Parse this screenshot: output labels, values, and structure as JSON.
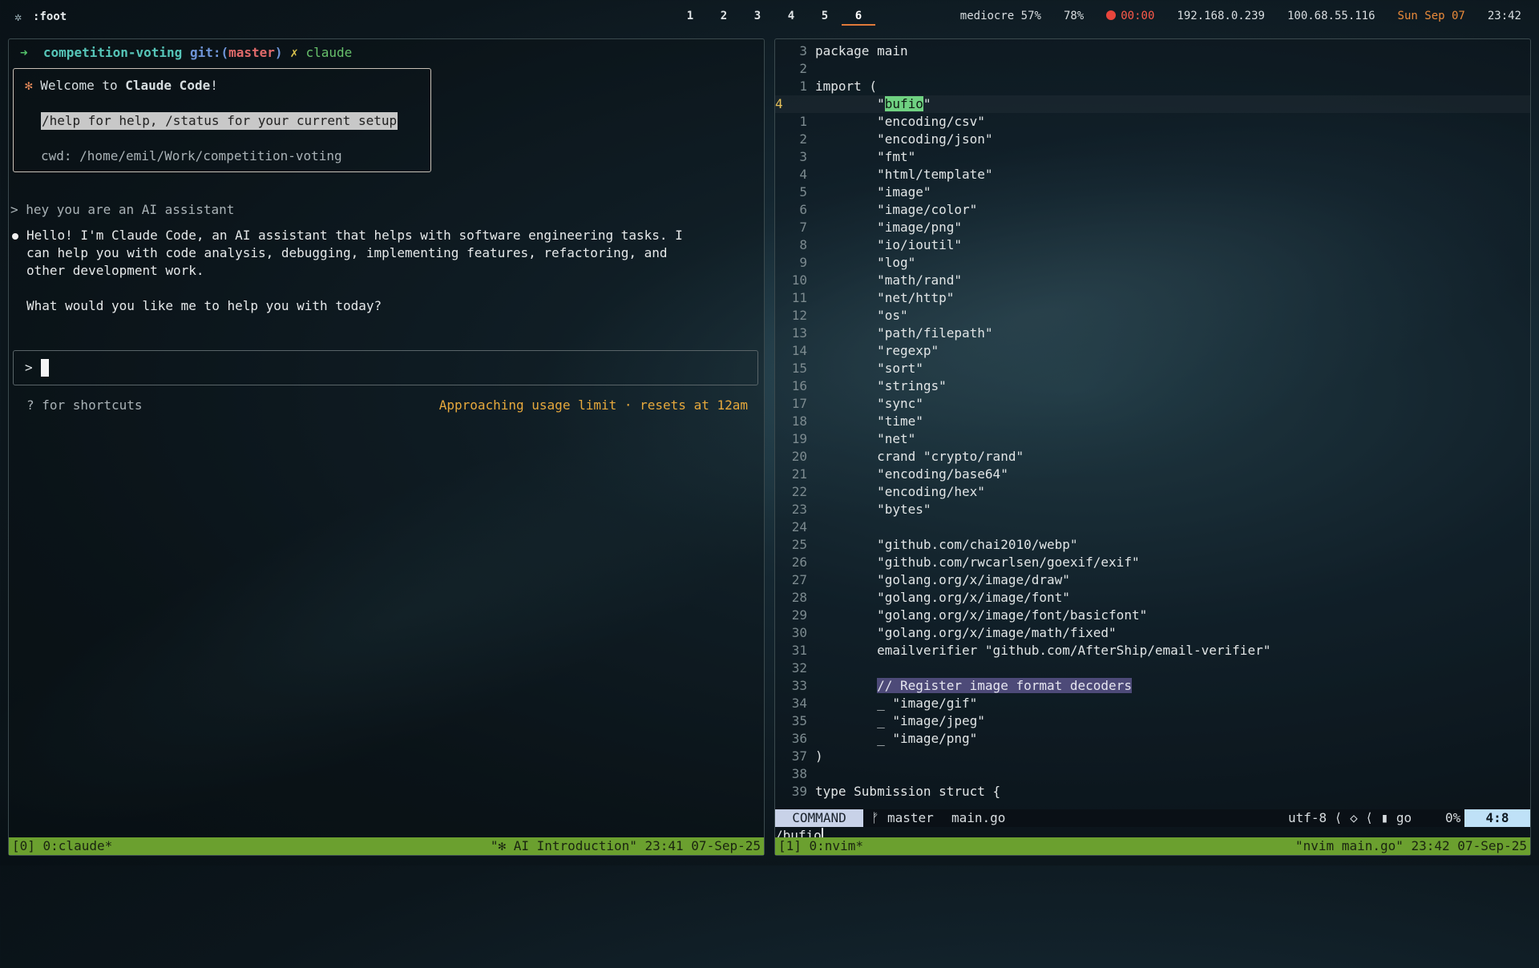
{
  "topbar": {
    "app_title": ":foot",
    "workspaces": [
      "1",
      "2",
      "3",
      "4",
      "5",
      "6"
    ],
    "active_workspace": "6",
    "wifi": "mediocre 57%",
    "battery": "78%",
    "timer": "00:00",
    "ip1": "192.168.0.239",
    "ip2": "100.68.55.116",
    "date": "Sun Sep 07",
    "time": "23:42"
  },
  "left": {
    "prompt": {
      "arrow": "➜",
      "dir": "competition-voting",
      "git_prefix": "git:(",
      "branch": "master",
      "git_suffix": ")",
      "cross": "✗",
      "command": "claude"
    },
    "welcome": {
      "star": "✻",
      "prefix": "Welcome to ",
      "app": "Claude Code",
      "suffix": "!",
      "help": "/help for help, /status for your current setup",
      "cwd": "cwd: /home/emil/Work/competition-voting"
    },
    "user_message": "> hey you are an AI assistant",
    "reply": "Hello! I'm Claude Code, an AI assistant that helps with software engineering tasks. I\ncan help you with code analysis, debugging, implementing features, refactoring, and\nother development work.",
    "reply2": "What would you like me to help you with today?",
    "input_prompt": ">",
    "shortcuts": "? for shortcuts",
    "usage": "Approaching usage limit · resets at 12am",
    "tmux_left": "[0] 0:claude*",
    "tmux_right": "\"✻ AI Introduction\" 23:41 07-Sep-25"
  },
  "editor": {
    "lines": [
      {
        "n": "3",
        "text": "package main"
      },
      {
        "n": "2",
        "text": ""
      },
      {
        "n": "1",
        "text": "import ("
      },
      {
        "n": "4",
        "text": "        \"bufio\"",
        "current": true
      },
      {
        "n": "1",
        "text": "        \"encoding/csv\""
      },
      {
        "n": "2",
        "text": "        \"encoding/json\""
      },
      {
        "n": "3",
        "text": "        \"fmt\""
      },
      {
        "n": "4",
        "text": "        \"html/template\""
      },
      {
        "n": "5",
        "text": "        \"image\""
      },
      {
        "n": "6",
        "text": "        \"image/color\""
      },
      {
        "n": "7",
        "text": "        \"image/png\""
      },
      {
        "n": "8",
        "text": "        \"io/ioutil\""
      },
      {
        "n": "9",
        "text": "        \"log\""
      },
      {
        "n": "10",
        "text": "        \"math/rand\""
      },
      {
        "n": "11",
        "text": "        \"net/http\""
      },
      {
        "n": "12",
        "text": "        \"os\""
      },
      {
        "n": "13",
        "text": "        \"path/filepath\""
      },
      {
        "n": "14",
        "text": "        \"regexp\""
      },
      {
        "n": "15",
        "text": "        \"sort\""
      },
      {
        "n": "16",
        "text": "        \"strings\""
      },
      {
        "n": "17",
        "text": "        \"sync\""
      },
      {
        "n": "18",
        "text": "        \"time\""
      },
      {
        "n": "19",
        "text": "        \"net\""
      },
      {
        "n": "20",
        "text": "        crand \"crypto/rand\""
      },
      {
        "n": "21",
        "text": "        \"encoding/base64\""
      },
      {
        "n": "22",
        "text": "        \"encoding/hex\""
      },
      {
        "n": "23",
        "text": "        \"bytes\""
      },
      {
        "n": "24",
        "text": ""
      },
      {
        "n": "25",
        "text": "        \"github.com/chai2010/webp\""
      },
      {
        "n": "26",
        "text": "        \"github.com/rwcarlsen/goexif/exif\""
      },
      {
        "n": "27",
        "text": "        \"golang.org/x/image/draw\""
      },
      {
        "n": "28",
        "text": "        \"golang.org/x/image/font\""
      },
      {
        "n": "29",
        "text": "        \"golang.org/x/image/font/basicfont\""
      },
      {
        "n": "30",
        "text": "        \"golang.org/x/image/math/fixed\""
      },
      {
        "n": "31",
        "text": "        emailverifier \"github.com/AfterShip/email-verifier\""
      },
      {
        "n": "32",
        "text": ""
      },
      {
        "n": "33",
        "text": "        // Register image format decoders",
        "comment": true
      },
      {
        "n": "34",
        "text": "        _ \"image/gif\""
      },
      {
        "n": "35",
        "text": "        _ \"image/jpeg\""
      },
      {
        "n": "36",
        "text": "        _ \"image/png\""
      },
      {
        "n": "37",
        "text": ")"
      },
      {
        "n": "38",
        "text": ""
      },
      {
        "n": "39",
        "text": "type Submission struct {"
      }
    ],
    "status": {
      "mode": "COMMAND",
      "branch_icon": "ᚠ",
      "branch": "master",
      "file": "main.go",
      "encoding": "utf-8 ⟨ ◇ ⟨ ▮ go",
      "percent": "0%",
      "position": "4:8"
    },
    "cmdline": "/bufio",
    "tmux_left": "[1] 0:nvim*",
    "tmux_right": "\"nvim main.go\" 23:42 07-Sep-25"
  }
}
